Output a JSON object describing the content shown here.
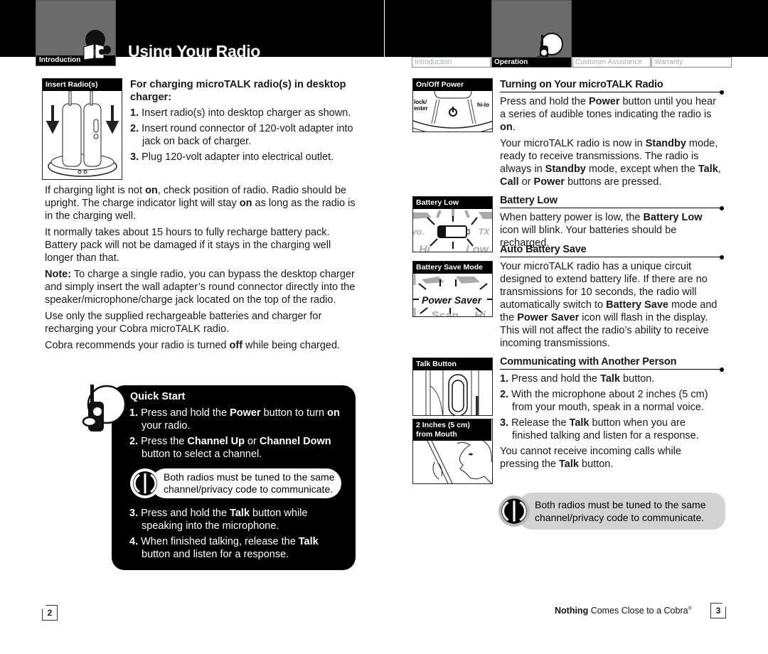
{
  "header": {
    "left_section_tab": "Introduction",
    "title": "Using Your Radio",
    "nav_tabs": [
      {
        "label": "Introduction",
        "active": false
      },
      {
        "label": "Operation",
        "active": true
      },
      {
        "label": "Customer Assistance",
        "active": false
      },
      {
        "label": "Warranty",
        "active": false
      }
    ]
  },
  "left_page": {
    "figure_charger": {
      "label": "Insert Radio(s)",
      "icon": "desktop-charger-illustration"
    },
    "charging": {
      "heading": "For charging microTALK radio(s) in desktop charger:",
      "steps": [
        {
          "n": "1.",
          "text": "Insert radio(s) into desktop charger as shown."
        },
        {
          "n": "2.",
          "text": "Insert round connector of 120-volt adapter into jack on back of charger."
        },
        {
          "n": "3.",
          "text": "Plug 120-volt adapter into electrical outlet."
        }
      ]
    },
    "paragraphs": {
      "p1_a": "If charging light is not ",
      "p1_b": "on",
      "p1_c": ", check position of radio. Radio should be upright. The charge indicator light will stay ",
      "p1_d": "on",
      "p1_e": " as long as the radio is in the charging well.",
      "p2": "It normally takes about 15 hours to fully recharge battery pack. Battery pack will not be damaged if it stays in the charging well longer than that.",
      "p3_label": "Note:",
      "p3": " To charge a single radio, you can bypass the desktop charger and simply insert the wall adapter’s round connector directly into the speaker/microphone/charge jack located on the top of the radio.",
      "p4": "Use only the supplied rechargeable batteries and charger for recharging your Cobra microTALK radio.",
      "p5_a": "Cobra recommends your radio is turned ",
      "p5_b": "off",
      "p5_c": " while being charged."
    },
    "quick_start": {
      "title": "Quick Start",
      "s1_n": "1.",
      "s1_a": "Press and hold the ",
      "s1_b": "Power",
      "s1_c": " button to turn ",
      "s1_d": "on",
      "s1_e": " your radio.",
      "s2_n": "2.",
      "s2_a": "Press the ",
      "s2_b": "Channel Up",
      "s2_c": " or ",
      "s2_d": "Channel Down",
      "s2_e": " button to select a channel.",
      "note": "Both radios must be tuned to the same channel/privacy code to communicate.",
      "s3_n": "3.",
      "s3_a": "Press and hold the ",
      "s3_b": "Talk",
      "s3_c": " button while speaking into the microphone.",
      "s4_n": "4.",
      "s4_a": "When finished talking, release the ",
      "s4_b": "Talk",
      "s4_c": " button and listen for a response."
    },
    "page_number": "2"
  },
  "right_page": {
    "figures": {
      "power": {
        "label": "On/Off Power",
        "left_btn": "lock/ enter",
        "right_btn": "hi-lo"
      },
      "battery_low": {
        "label": "Battery Low",
        "seg_left": "vo.",
        "seg_right": "TX",
        "seg_bl": "Hi",
        "seg_br": "Low"
      },
      "battery_save": {
        "label": "Battery Save Mode",
        "display_text": "Power Saver",
        "seg_bl": "Scan",
        "seg_br": "Hi"
      },
      "talk": {
        "label": "Talk Button"
      },
      "mouth": {
        "label": "2 Inches (5 cm) from Mouth"
      }
    },
    "turning_on": {
      "heading": "Turning on Your microTALK Radio",
      "p1_a": "Press and hold the ",
      "p1_b": "Power",
      "p1_c": " button until you hear a series of audible tones indicating the radio is ",
      "p1_d": "on",
      "p1_e": ".",
      "p2_a": "Your microTALK radio is now in ",
      "p2_b": "Standby",
      "p2_c": " mode, ready to receive transmissions. The radio is always in ",
      "p2_d": "Standby",
      "p2_e": " mode, except when the ",
      "p2_f": "Talk",
      "p2_g": ", ",
      "p2_h": "Call",
      "p2_i": " or ",
      "p2_j": "Power",
      "p2_k": " buttons are pressed."
    },
    "battery_low": {
      "heading": "Battery Low",
      "p_a": "When battery power is low, the ",
      "p_b": "Battery Low",
      "p_c": " icon will blink. Your batteries should be recharged."
    },
    "auto_save": {
      "heading": "Auto Battery Save",
      "p_a": "Your microTALK radio has a unique circuit designed to extend battery life. If there are no transmissions for 10 seconds, the radio will automatically switch to ",
      "p_b": "Battery Save",
      "p_c": " mode and the ",
      "p_d": "Power Saver",
      "p_e": " icon will flash in the display. This will not affect the radio’s ability to receive incoming transmissions."
    },
    "communicating": {
      "heading": "Communicating with Another Person",
      "s1_n": "1.",
      "s1_a": "Press and hold the ",
      "s1_b": "Talk",
      "s1_c": " button.",
      "s2_n": "2.",
      "s2": "With the microphone about 2 inches (5 cm) from your mouth, speak in a normal voice.",
      "s3_n": "3.",
      "s3_a": "Release the ",
      "s3_b": "Talk",
      "s3_c": " button when you are finished talking and listen for a response.",
      "p_a": "You cannot receive incoming calls while pressing the ",
      "p_b": "Talk",
      "p_c": " button.",
      "note": "Both radios must be tuned to the same channel/privacy code to communicate."
    },
    "tagline_bold": "Nothing",
    "tagline_rest": " Comes Close to a Cobra",
    "tagline_reg": "®",
    "page_number": "3"
  }
}
